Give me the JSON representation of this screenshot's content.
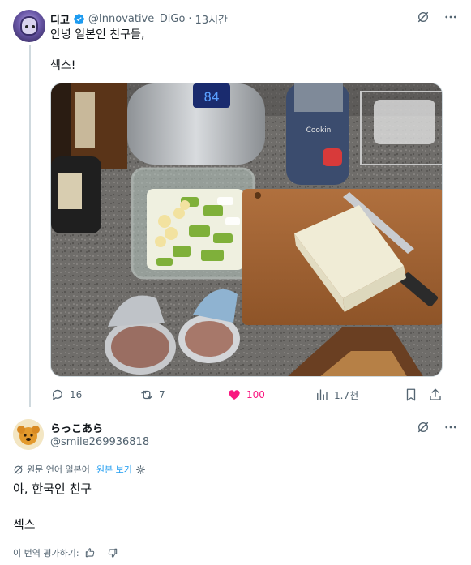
{
  "post": {
    "author_name": "디고",
    "author_handle": "@Innovative_DiGo",
    "time": "13시간",
    "text_line1": "안녕 일본인 친구들,",
    "text_line2": "섹스!",
    "photo_appliance_label": "Cookin",
    "photo_display_digits": "84",
    "verified_color": "#1d9bf0",
    "actions": {
      "replies": "16",
      "reposts": "7",
      "likes": "100",
      "views": "1.7천"
    }
  },
  "reply": {
    "author_name": "らっこあら",
    "author_handle": "@smile269936818",
    "lang_note": "원문 언어 일본어",
    "lang_link": "원본 보기",
    "text_line1": "야, 한국인 친구",
    "text_line2": "섹스",
    "rate_label": "이 번역 평가하기:"
  },
  "colors": {
    "like": "#f91880",
    "muted": "#536471",
    "link": "#1d9bf0"
  },
  "icons": [
    "grok-icon",
    "more-icon",
    "reply-icon",
    "repost-icon",
    "like-icon",
    "views-icon",
    "bookmark-icon",
    "share-icon",
    "translate-icon",
    "settings-icon",
    "thumbs-up-icon",
    "thumbs-down-icon"
  ]
}
